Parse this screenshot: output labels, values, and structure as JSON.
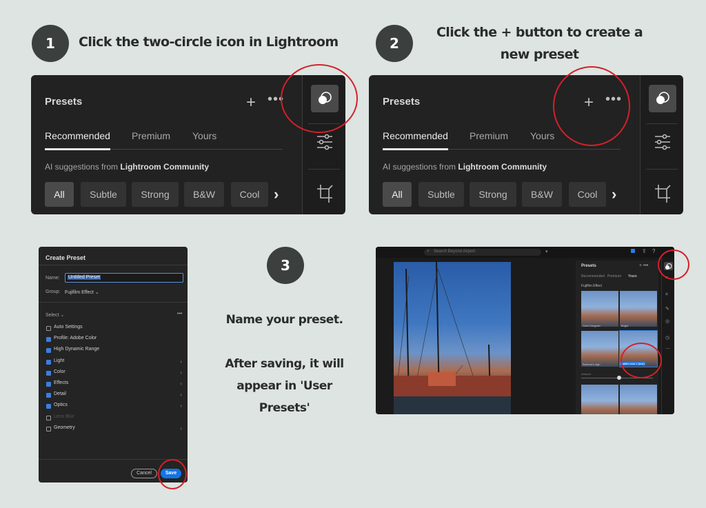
{
  "steps": {
    "step1": {
      "number": "1",
      "heading": "Click the two-circle icon in Lightroom"
    },
    "step2": {
      "number": "2",
      "heading_line1": "Click the + button to create a",
      "heading_line2": "new preset"
    },
    "step3": {
      "number": "3",
      "line1": "Name your preset.",
      "line2": "After saving, it will",
      "line3": "appear in 'User",
      "line4": "Presets'"
    }
  },
  "presets_panel": {
    "title": "Presets",
    "plus": "+",
    "more": "•••",
    "tabs": [
      "Recommended",
      "Premium",
      "Yours"
    ],
    "ai_prefix": "AI suggestions from",
    "ai_source": "Lightroom Community",
    "chips": [
      "All",
      "Subtle",
      "Strong",
      "B&W",
      "Cool"
    ],
    "chevron": "›",
    "rail_icons": [
      "presets-icon",
      "sliders-icon",
      "crop-icon"
    ]
  },
  "dialog": {
    "title": "Create Preset",
    "name_label": "Name:",
    "name_value": "Untitled Preset",
    "group_label": "Group:",
    "group_value": "Fujifilm Effect ⌄",
    "select_label": "Select ⌄",
    "more": "•••",
    "settings": [
      {
        "label": "Auto Settings",
        "checked": false,
        "dim": false,
        "arrow": false
      },
      {
        "label": "Profile: Adobe Color",
        "checked": true,
        "dim": false,
        "arrow": false
      },
      {
        "label": "High Dynamic Range",
        "checked": true,
        "dim": false,
        "arrow": false
      },
      {
        "label": "Light",
        "checked": true,
        "dim": false,
        "arrow": true
      },
      {
        "label": "Color",
        "checked": true,
        "dim": false,
        "arrow": true
      },
      {
        "label": "Effects",
        "checked": true,
        "dim": false,
        "arrow": true
      },
      {
        "label": "Detail",
        "checked": true,
        "dim": false,
        "arrow": true
      },
      {
        "label": "Optics",
        "checked": true,
        "dim": false,
        "arrow": true
      },
      {
        "label": "Lens Blur",
        "checked": false,
        "dim": true,
        "arrow": false
      },
      {
        "label": "Geometry",
        "checked": false,
        "dim": false,
        "arrow": true
      }
    ],
    "cancel_label": "Cancel",
    "save_label": "Save"
  },
  "screenshot4": {
    "search_placeholder": "Search Beyond Airport",
    "panel_title": "Presets",
    "tabs": [
      "Recommended",
      "Premium",
      "Yours"
    ],
    "group": "Fujifilm Effect",
    "thumb_labels": [
      "Gold Gangster",
      "Bright",
      "Barbara's sign",
      "Fujifilm look 1 (test)"
    ],
    "amount_label": "Amount"
  },
  "colors": {
    "background": "#dde4e1",
    "step_circle": "#3b403f",
    "highlight": "#d4202a",
    "accent_blue": "#1473e6"
  }
}
